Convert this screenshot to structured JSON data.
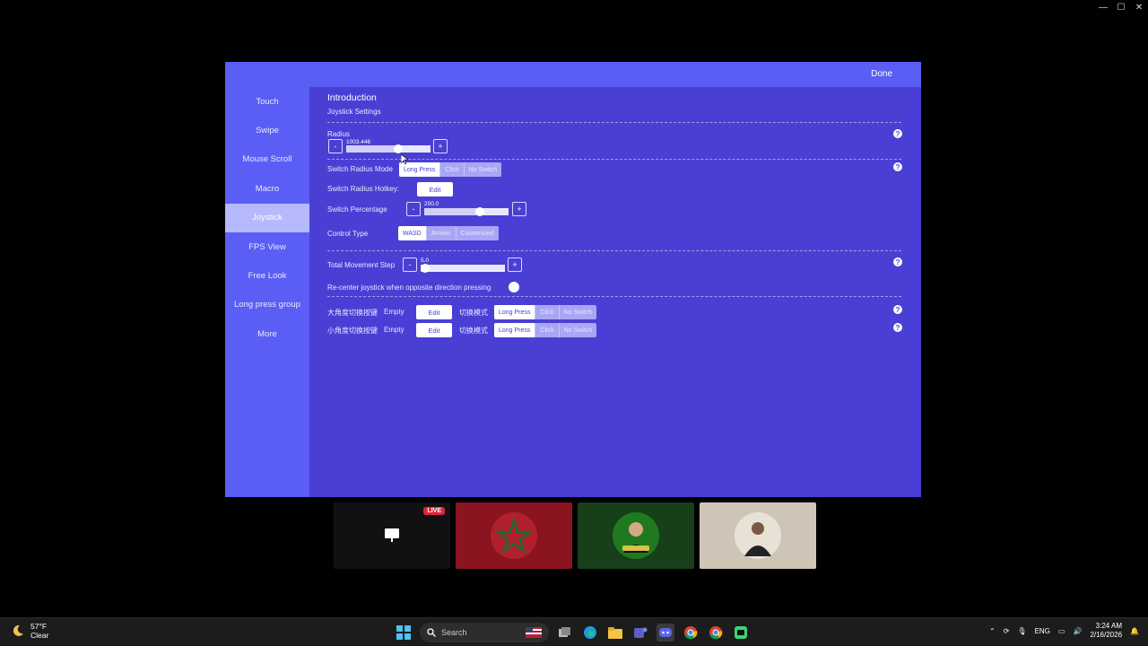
{
  "window_controls": [
    "—",
    "☐",
    "✕"
  ],
  "topbar": {
    "done_label": "Done"
  },
  "sidebar": {
    "items": [
      {
        "label": "Touch"
      },
      {
        "label": "Swipe"
      },
      {
        "label": "Mouse Scroll"
      },
      {
        "label": "Macro"
      },
      {
        "label": "Joystick",
        "active": true
      },
      {
        "label": "FPS View"
      },
      {
        "label": "Free Look"
      },
      {
        "label": "Long press group"
      },
      {
        "label": "More"
      }
    ]
  },
  "content": {
    "intro_title": "Introduction",
    "section_title": "Joystick Settings",
    "radius": {
      "label": "Radius",
      "value": "1003.446",
      "minus": "-",
      "plus": "+"
    },
    "switch_radius_mode": {
      "label": "Switch Radius Mode",
      "options": [
        "Long Press",
        "Click",
        "No Switch"
      ],
      "selected": "Long Press"
    },
    "switch_radius_hotkey": {
      "label": "Switch Radius Hotkey:",
      "button": "Edit"
    },
    "switch_percentage": {
      "label": "Switch Percentage",
      "value": "200.0",
      "minus": "-",
      "plus": "+"
    },
    "control_type": {
      "label": "Control Type",
      "options": [
        "WASD",
        "Arrows",
        "Customized"
      ],
      "selected": "WASD"
    },
    "total_movement_step": {
      "label": "Total Movement Step",
      "value": "5.0",
      "minus": "-",
      "plus": "+"
    },
    "recenter": {
      "label": "Re-center joystick when opposite direction pressing"
    },
    "big_angle": {
      "label": "大角度切换按键",
      "value": "Empty",
      "button": "Edit",
      "mode_label": "切换模式",
      "options": [
        "Long Press",
        "Click",
        "No Switch"
      ],
      "selected": "Long Press"
    },
    "small_angle": {
      "label": "小角度切换按键",
      "value": "Empty",
      "button": "Edit",
      "mode_label": "切换模式",
      "options": [
        "Long Press",
        "Click",
        "No Switch"
      ],
      "selected": "Long Press"
    },
    "help_glyph": "?"
  },
  "thumbnails": {
    "live_badge": "LIVE"
  },
  "taskbar": {
    "weather_temp": "57°F",
    "weather_desc": "Clear",
    "search_placeholder": "Search",
    "language": "ENG",
    "time": "3:24 AM",
    "date": "2/16/2026"
  },
  "colors": {
    "panel_bg": "#4a3fd4",
    "sidebar_bg": "#5b5ef5",
    "active_item": "#b6b9fb",
    "live_red": "#e0243a"
  }
}
